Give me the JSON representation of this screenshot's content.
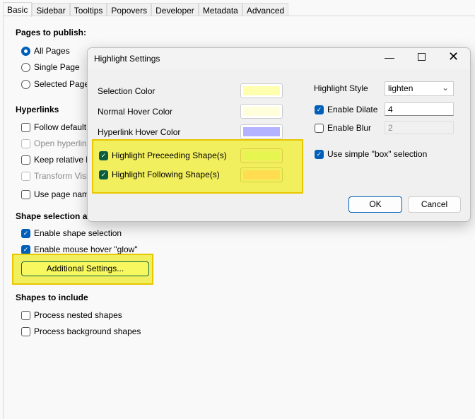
{
  "tabs": [
    "Basic",
    "Sidebar",
    "Tooltips",
    "Popovers",
    "Developer",
    "Metadata",
    "Advanced"
  ],
  "active_tab": "Basic",
  "pages": {
    "heading": "Pages to publish:",
    "options": [
      {
        "label": "All Pages",
        "selected": true
      },
      {
        "label": "Single Page",
        "selected": false
      },
      {
        "label": "Selected Pages",
        "selected": false
      }
    ]
  },
  "hyperlinks": {
    "heading": "Hyperlinks",
    "items": [
      {
        "label": "Follow default li",
        "checked": false,
        "enabled": true
      },
      {
        "label": "Open hyperlinks",
        "checked": false,
        "enabled": false
      },
      {
        "label": "Keep relative lir",
        "checked": false,
        "enabled": true
      },
      {
        "label": "Transform Visio",
        "checked": false,
        "enabled": false
      },
      {
        "label": "Use page name",
        "checked": false,
        "enabled": true
      }
    ]
  },
  "shape_selection": {
    "heading": "Shape selection a",
    "items": [
      {
        "label": "Enable shape selection",
        "checked": true
      },
      {
        "label": "Enable mouse hover \"glow\"",
        "checked": true
      }
    ],
    "button": "Additional Settings..."
  },
  "shapes_include": {
    "heading": "Shapes to include",
    "items": [
      {
        "label": "Process nested shapes",
        "checked": false
      },
      {
        "label": "Process background shapes",
        "checked": false
      }
    ]
  },
  "dialog": {
    "title": "Highlight Settings",
    "colors": [
      {
        "label": "Selection Color",
        "color": "#ffffb0"
      },
      {
        "label": "Normal Hover Color",
        "color": "#ffffdc"
      },
      {
        "label": "Hyperlink Hover Color",
        "color": "#b3b3ff"
      }
    ],
    "highlight": [
      {
        "label": "Highlight Preceeding Shape(s)",
        "checked": true,
        "color": "#e6f550"
      },
      {
        "label": "Highlight Following Shape(s)",
        "checked": true,
        "color": "#ffdc50"
      }
    ],
    "style_label": "Highlight Style",
    "style_value": "lighten",
    "dilate": {
      "label": "Enable Dilate",
      "checked": true,
      "value": "4"
    },
    "blur": {
      "label": "Enable Blur",
      "checked": false,
      "value": "2"
    },
    "box": {
      "label": "Use simple \"box\" selection",
      "checked": true
    },
    "ok": "OK",
    "cancel": "Cancel"
  },
  "annotation_color": "#f2ef5e"
}
